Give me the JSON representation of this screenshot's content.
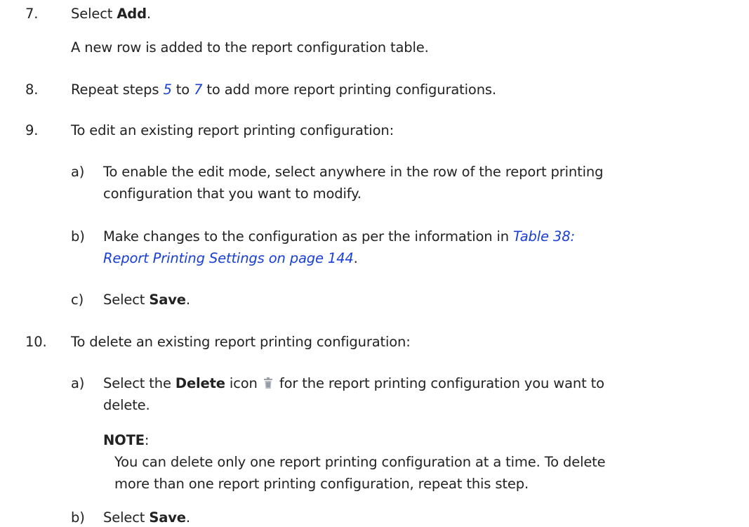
{
  "steps": {
    "s7": {
      "number": "7.",
      "prefix": "Select ",
      "bold": "Add",
      "suffix": ".",
      "result": "A new row is added to the report configuration table."
    },
    "s8": {
      "number": "8.",
      "t1": "Repeat steps ",
      "link1": "5",
      "t2": " to ",
      "link2": "7",
      "t3": " to add more report printing configurations."
    },
    "s9": {
      "number": "9.",
      "text": "To edit an existing report printing configuration:",
      "a": {
        "letter": "a)",
        "line1": "To enable the edit mode, select anywhere in the row of the report printing",
        "line2": "configuration that you want to modify."
      },
      "b": {
        "letter": "b)",
        "t1": "Make changes to the configuration as per the information in ",
        "link_line1": "Table 38:",
        "link_line2": "Report Printing Settings on page 144",
        "t2": "."
      },
      "c": {
        "letter": "c)",
        "prefix": "Select ",
        "bold": "Save",
        "suffix": "."
      }
    },
    "s10": {
      "number": "10.",
      "text": "To delete an existing report printing configuration:",
      "a": {
        "letter": "a)",
        "prefix": "Select the ",
        "bold": "Delete",
        "mid": " icon",
        "icon": "trash-icon",
        "rest": " for the report printing configuration you want to",
        "line2": "delete."
      },
      "note": {
        "label": "NOTE",
        "colon": ":",
        "line1": "You can delete only one report printing configuration at a time. To delete",
        "line2": "more than one report printing configuration, repeat this step."
      },
      "b": {
        "letter": "b)",
        "prefix": "Select ",
        "bold": "Save",
        "suffix": "."
      }
    }
  },
  "colors": {
    "text": "#222222",
    "link": "#1a3fd6"
  }
}
